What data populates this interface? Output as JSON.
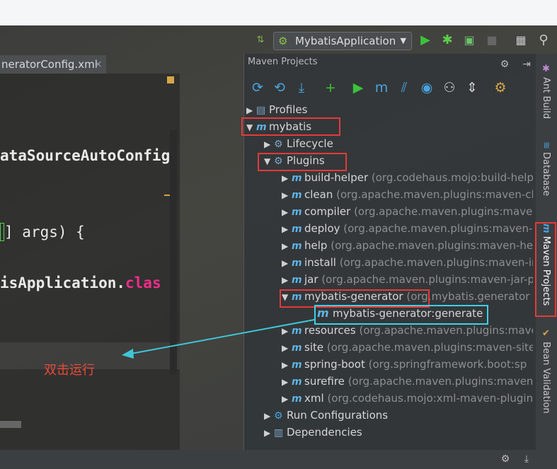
{
  "run_config": {
    "label": "MybatisApplication"
  },
  "editor": {
    "tab_label": "neratorConfig.xml",
    "tab_close": "×",
    "lines": [
      {
        "text": "ataSourceAutoConfig"
      },
      {
        "text": "] args) {"
      },
      {
        "text": "isApplication.",
        "keyword": "clas"
      }
    ]
  },
  "maven": {
    "title": "Maven Projects",
    "tree": [
      {
        "label": "Profiles",
        "detail": ""
      },
      {
        "label": "mybatis",
        "detail": ""
      },
      {
        "label": "Lifecycle",
        "detail": ""
      },
      {
        "label": "Plugins",
        "detail": ""
      },
      {
        "label": "build-helper",
        "detail": "(org.codehaus.mojo:build-help"
      },
      {
        "label": "clean",
        "detail": "(org.apache.maven.plugins:maven-cle"
      },
      {
        "label": "compiler",
        "detail": "(org.apache.maven.plugins:maven"
      },
      {
        "label": "deploy",
        "detail": "(org.apache.maven.plugins:maven-"
      },
      {
        "label": "help",
        "detail": "(org.apache.maven.plugins:maven-he"
      },
      {
        "label": "install",
        "detail": "(org.apache.maven.plugins:maven-in"
      },
      {
        "label": "jar",
        "detail": "(org.apache.maven.plugins:maven-jar-p"
      },
      {
        "label": "mybatis-generator",
        "detail": "(org.mybatis.generator"
      },
      {
        "label": "mybatis-generator:generate",
        "detail": ""
      },
      {
        "label": "resources",
        "detail": "(org.apache.maven.plugins:mave"
      },
      {
        "label": "site",
        "detail": "(org.apache.maven.plugins:maven-site-"
      },
      {
        "label": "spring-boot",
        "detail": "(org.springframework.boot:sp"
      },
      {
        "label": "surefire",
        "detail": "(org.apache.maven.plugins:maven-"
      },
      {
        "label": "xml",
        "detail": "(org.codehaus.mojo:xml-maven-plugin"
      },
      {
        "label": "Run Configurations",
        "detail": ""
      },
      {
        "label": "Dependencies",
        "detail": ""
      }
    ]
  },
  "sidebar": {
    "ant_build": "Ant Build",
    "database": "Database",
    "maven_projects": "Maven Projects",
    "bean_validation": "Bean Validation"
  },
  "annotation": {
    "text": "双击运行"
  },
  "colors": {
    "highlight_red": "#e43a3a",
    "highlight_cyan": "#3fd0e6",
    "arrow": "#3fc6d8"
  }
}
